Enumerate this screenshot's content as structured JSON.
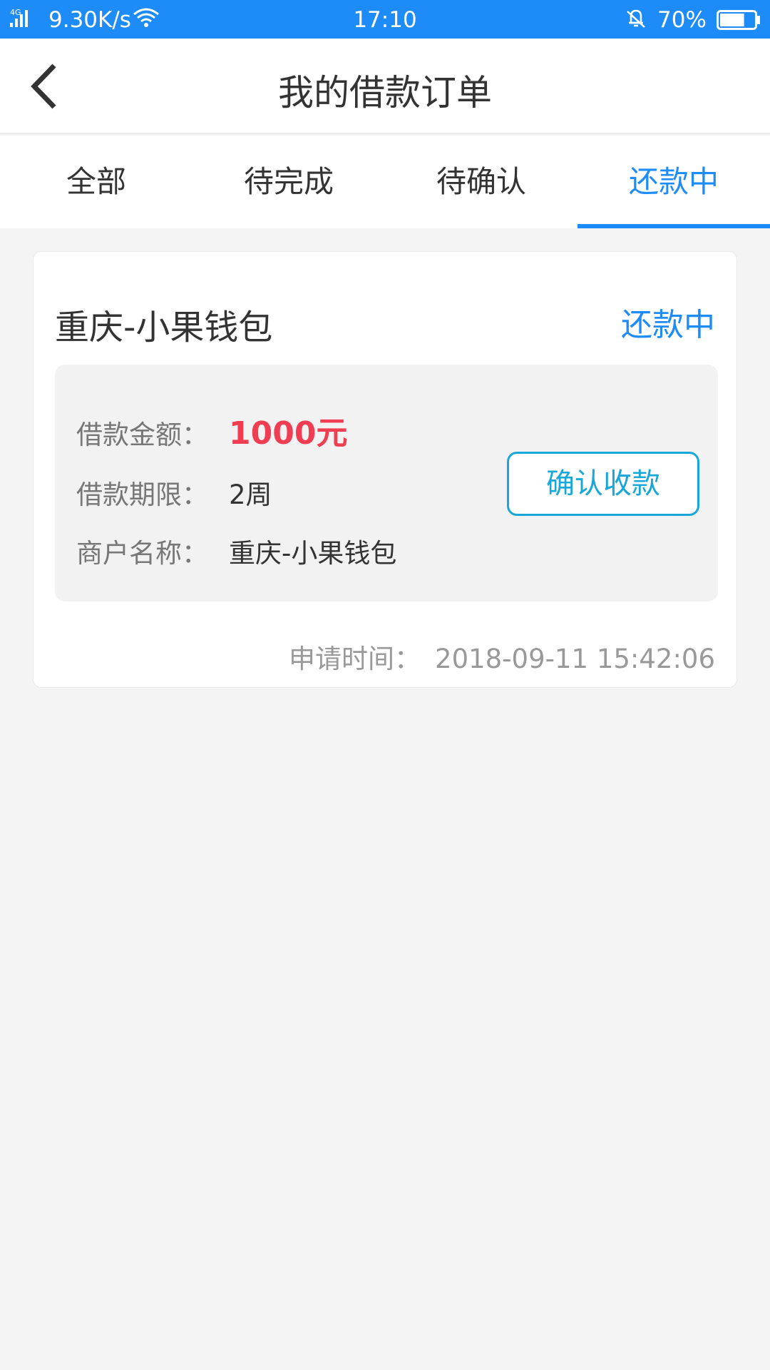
{
  "status_bar": {
    "network": "4G",
    "speed": "9.30K/s",
    "time": "17:10",
    "battery_percent": "70%",
    "battery_level": 0.7,
    "bg_color": "#1d8cf8",
    "icons": [
      "signal-icon",
      "wifi-icon",
      "alarm-bell-icon",
      "battery-icon"
    ]
  },
  "header": {
    "title": "我的借款订单",
    "back_icon": "chevron-left-icon"
  },
  "tabs": [
    {
      "label": "全部",
      "active": false
    },
    {
      "label": "待完成",
      "active": false
    },
    {
      "label": "待确认",
      "active": false
    },
    {
      "label": "还款中",
      "active": true
    }
  ],
  "order": {
    "merchant_title": "重庆-小果钱包",
    "status": "还款中",
    "amount_label": "借款金额：",
    "amount_value": "1000元",
    "term_label": "借款期限：",
    "term_value": "2周",
    "merchant_label": "商户名称：",
    "merchant_value": "重庆-小果钱包",
    "confirm_button": "确认收款",
    "apply_time_label": "申请时间：",
    "apply_time_value": "2018-09-11 15:42:06"
  },
  "colors": {
    "accent": "#1d8cf8",
    "amount": "#ef3d52",
    "button": "#17a7d9"
  }
}
